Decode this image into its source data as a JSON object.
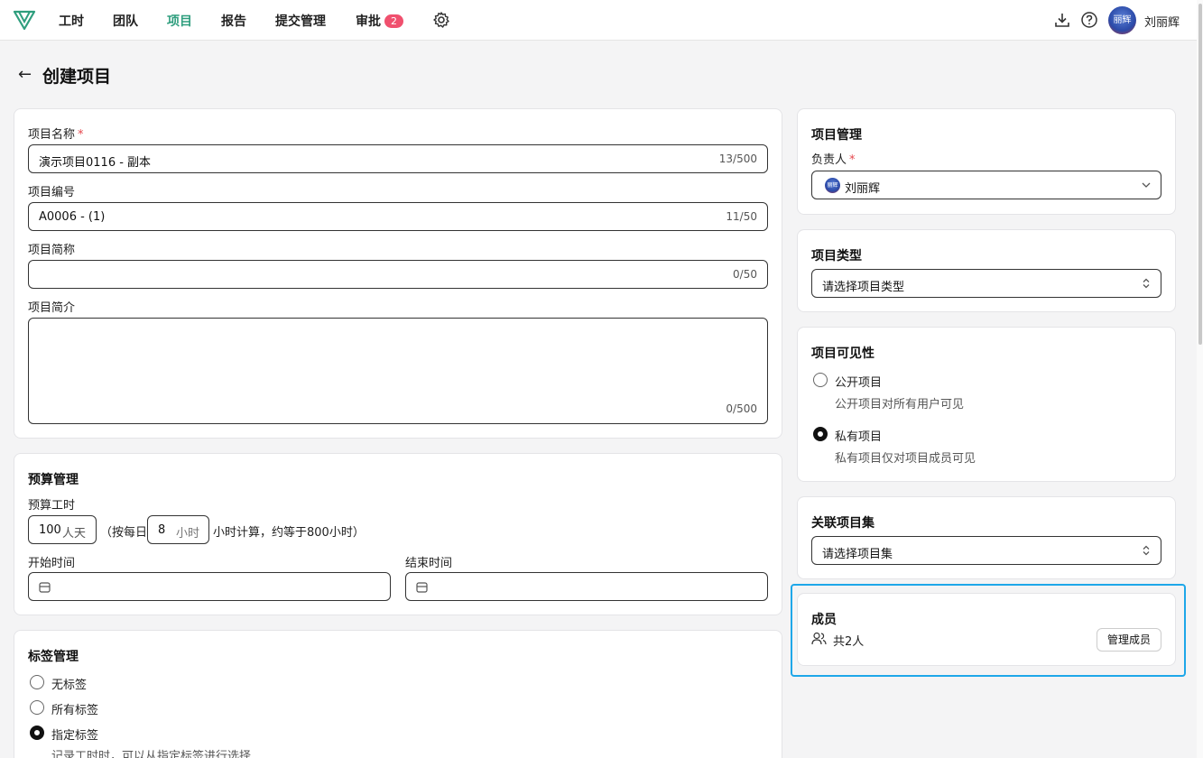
{
  "nav": {
    "items": [
      "工时",
      "团队",
      "项目",
      "报告",
      "提交管理",
      "审批"
    ],
    "approval_badge": "2",
    "user_name": "刘丽辉",
    "avatar_text": "丽辉"
  },
  "header": {
    "back_label": "←",
    "title": "创建项目"
  },
  "basic": {
    "name_label": "项目名称",
    "name_value": "演示项目0116 - 副本",
    "name_count": "13/500",
    "code_label": "项目编号",
    "code_value": "A0006 - (1)",
    "code_count": "11/50",
    "short_label": "项目简称",
    "short_count": "0/50",
    "intro_label": "项目简介",
    "intro_count": "0/500",
    "required_mark": "*"
  },
  "budget": {
    "title": "预算管理",
    "hours_label": "预算工时",
    "days_value": "100",
    "days_unit": "人天",
    "per_day_prefix": "（按每日",
    "per_day_value": "8",
    "per_day_unit": "小时",
    "per_day_suffix": "小时计算，约等于800小时）",
    "start_label": "开始时间",
    "end_label": "结束时间"
  },
  "tags": {
    "title": "标签管理",
    "options": [
      "无标签",
      "所有标签",
      "指定标签"
    ],
    "selected": 2,
    "hint": "记录工时时，可以从指定标签进行选择"
  },
  "management": {
    "title": "项目管理",
    "owner_label": "负责人",
    "owner_value": "刘丽辉",
    "owner_avatar": "丽辉"
  },
  "project_type": {
    "title": "项目类型",
    "placeholder": "请选择项目类型"
  },
  "visibility": {
    "title": "项目可见性",
    "public_label": "公开项目",
    "public_desc": "公开项目对所有用户可见",
    "private_label": "私有项目",
    "private_desc": "私有项目仅对项目成员可见",
    "selected": "private"
  },
  "project_set": {
    "title": "关联项目集",
    "placeholder": "请选择项目集"
  },
  "members": {
    "title": "成员",
    "count_text": "共2人",
    "manage_label": "管理成员"
  },
  "colors": {
    "accent": "#2f9e7e",
    "badge": "#f0506e",
    "highlight": "#1ea7e9",
    "required": "#e5484d"
  }
}
